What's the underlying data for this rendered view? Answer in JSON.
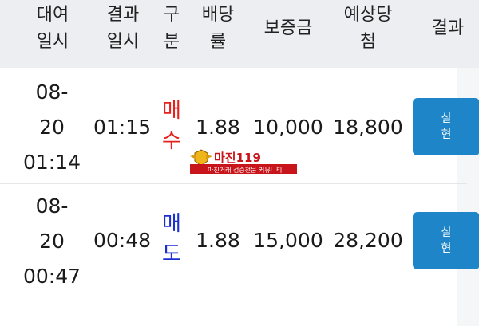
{
  "header": {
    "rental_time": [
      "대여",
      "일시"
    ],
    "result_time": [
      "결과",
      "일시"
    ],
    "type": [
      "구",
      "분"
    ],
    "odds": [
      "배당",
      "률"
    ],
    "deposit": "보증금",
    "expected_payout": [
      "예상당",
      "첨"
    ],
    "result": "결과"
  },
  "rows": [
    {
      "rental_time": [
        "08-",
        "20",
        "01:14"
      ],
      "result_time": "01:15",
      "type": [
        "매",
        "수"
      ],
      "odds": "1.88",
      "deposit": "10,000",
      "expected_payout": "18,800",
      "result_button": [
        "실",
        "현"
      ]
    },
    {
      "rental_time": [
        "08-",
        "20",
        "00:47"
      ],
      "result_time": "00:48",
      "type": [
        "매",
        "도"
      ],
      "odds": "1.88",
      "deposit": "15,000",
      "expected_payout": "28,200",
      "result_button": [
        "실",
        "현"
      ]
    }
  ],
  "watermark": {
    "brand": "마진119",
    "tagline": "마진거래 검증전문 커뮤니티"
  },
  "colors": {
    "header_bg": "#eceef2",
    "buy": "#e8201b",
    "sell": "#1b2fd1",
    "button": "#1e86c8"
  }
}
